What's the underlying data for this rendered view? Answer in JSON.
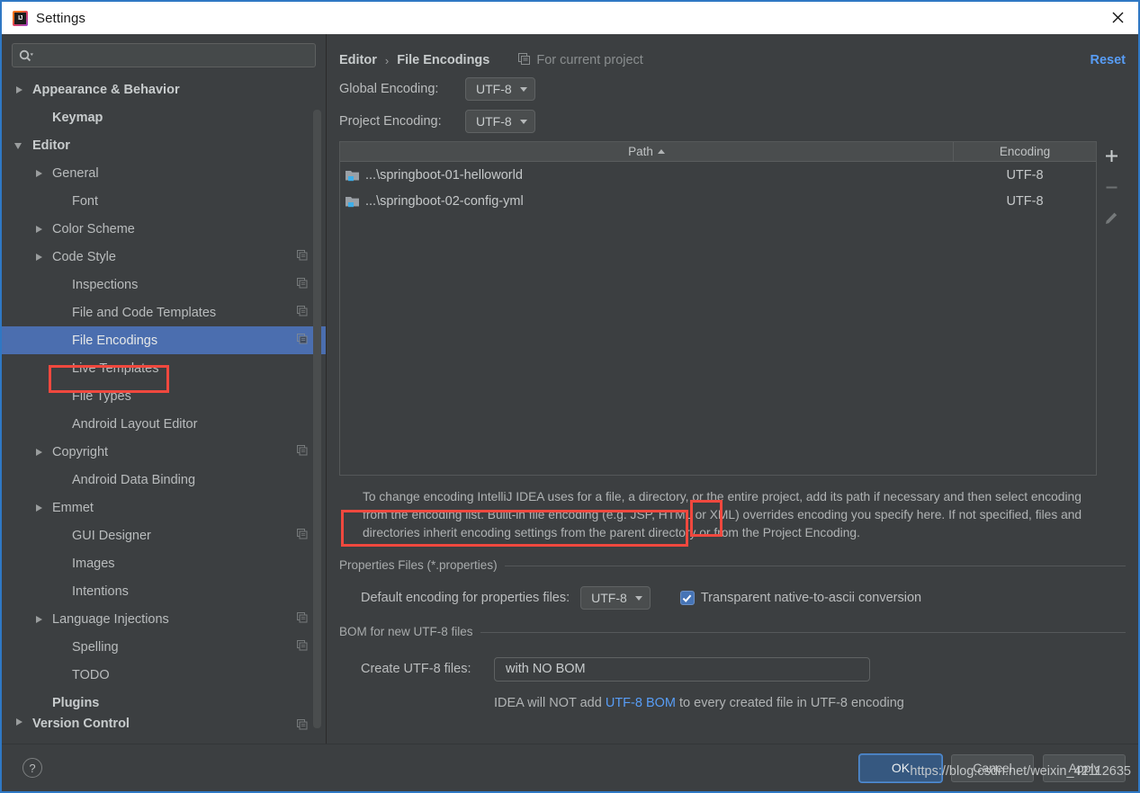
{
  "window": {
    "title": "Settings",
    "logo_icon": "intellij-idea-logo",
    "close_icon": "close-icon"
  },
  "sidebar": {
    "search": {
      "placeholder": "",
      "value": "",
      "icon": "search-icon"
    },
    "items": [
      {
        "label": "Appearance & Behavior",
        "arrow": "right",
        "bold": true,
        "indent": 14,
        "badge": false
      },
      {
        "label": "Keymap",
        "arrow": "none",
        "bold": true,
        "indent": 36,
        "badge": false
      },
      {
        "label": "Editor",
        "arrow": "down",
        "bold": true,
        "indent": 14,
        "badge": false
      },
      {
        "label": "General",
        "arrow": "right",
        "bold": false,
        "indent": 36,
        "badge": false
      },
      {
        "label": "Font",
        "arrow": "none",
        "bold": false,
        "indent": 58,
        "badge": false
      },
      {
        "label": "Color Scheme",
        "arrow": "right",
        "bold": false,
        "indent": 36,
        "badge": false
      },
      {
        "label": "Code Style",
        "arrow": "right",
        "bold": false,
        "indent": 36,
        "badge": true
      },
      {
        "label": "Inspections",
        "arrow": "none",
        "bold": false,
        "indent": 58,
        "badge": true
      },
      {
        "label": "File and Code Templates",
        "arrow": "none",
        "bold": false,
        "indent": 58,
        "badge": true
      },
      {
        "label": "File Encodings",
        "arrow": "none",
        "bold": false,
        "indent": 58,
        "badge": true,
        "selected": true
      },
      {
        "label": "Live Templates",
        "arrow": "none",
        "bold": false,
        "indent": 58,
        "badge": false
      },
      {
        "label": "File Types",
        "arrow": "none",
        "bold": false,
        "indent": 58,
        "badge": false
      },
      {
        "label": "Android Layout Editor",
        "arrow": "none",
        "bold": false,
        "indent": 58,
        "badge": false
      },
      {
        "label": "Copyright",
        "arrow": "right",
        "bold": false,
        "indent": 36,
        "badge": true
      },
      {
        "label": "Android Data Binding",
        "arrow": "none",
        "bold": false,
        "indent": 58,
        "badge": false
      },
      {
        "label": "Emmet",
        "arrow": "right",
        "bold": false,
        "indent": 36,
        "badge": false
      },
      {
        "label": "GUI Designer",
        "arrow": "none",
        "bold": false,
        "indent": 58,
        "badge": true
      },
      {
        "label": "Images",
        "arrow": "none",
        "bold": false,
        "indent": 58,
        "badge": false
      },
      {
        "label": "Intentions",
        "arrow": "none",
        "bold": false,
        "indent": 58,
        "badge": false
      },
      {
        "label": "Language Injections",
        "arrow": "right",
        "bold": false,
        "indent": 36,
        "badge": true
      },
      {
        "label": "Spelling",
        "arrow": "none",
        "bold": false,
        "indent": 58,
        "badge": true
      },
      {
        "label": "TODO",
        "arrow": "none",
        "bold": false,
        "indent": 58,
        "badge": false
      },
      {
        "label": "Plugins",
        "arrow": "none",
        "bold": true,
        "indent": 36,
        "badge": false
      },
      {
        "label": "Version Control",
        "arrow": "right",
        "bold": true,
        "indent": 14,
        "badge": true,
        "clipped": true
      }
    ]
  },
  "pane": {
    "breadcrumb": {
      "parent": "Editor",
      "separator": "›",
      "current": "File Encodings"
    },
    "for_current_project": "For current project",
    "project_scope_icon": "copy-icon",
    "reset_label": "Reset",
    "global_encoding": {
      "label": "Global Encoding:",
      "value": "UTF-8"
    },
    "project_encoding": {
      "label": "Project Encoding:",
      "value": "UTF-8"
    },
    "table": {
      "columns": [
        "Path",
        "Encoding"
      ],
      "sort_column": "Path",
      "sort_direction": "ascending",
      "rows": [
        {
          "icon": "module-folder-icon",
          "path": "...\\springboot-01-helloworld",
          "encoding": "UTF-8"
        },
        {
          "icon": "module-folder-icon",
          "path": "...\\springboot-02-config-yml",
          "encoding": "UTF-8"
        }
      ],
      "toolbar": [
        {
          "name": "add-button",
          "icon": "plus-icon",
          "enabled": true
        },
        {
          "name": "remove-button",
          "icon": "minus-icon",
          "enabled": false
        },
        {
          "name": "edit-button",
          "icon": "pencil-icon",
          "enabled": false
        }
      ]
    },
    "description": "To change encoding IntelliJ IDEA uses for a file, a directory, or the entire project, add its path if necessary and then select encoding from the encoding list. Built-in file encoding (e.g. JSP, HTML or XML) overrides encoding you specify here. If not specified, files and directories inherit encoding settings from the parent directory or from the Project Encoding.",
    "properties_group": {
      "title": "Properties Files (*.properties)",
      "default_encoding_label": "Default encoding for properties files:",
      "default_encoding_value": "UTF-8",
      "transparent_label": "Transparent native-to-ascii conversion",
      "transparent_checked": true
    },
    "bom_group": {
      "title": "BOM for new UTF-8 files",
      "create_label": "Create UTF-8 files:",
      "create_value": "with NO BOM",
      "note_before": "IDEA will NOT add ",
      "note_link": "UTF-8 BOM",
      "note_after": " to every created file in UTF-8 encoding"
    }
  },
  "footer": {
    "help_label": "?",
    "ok_label": "OK",
    "cancel_label": "Cancel",
    "apply_label": "Apply"
  },
  "watermark": "https://blog.csdn.net/weixin_42112635",
  "colors": {
    "accent_blue": "#4b6eaf",
    "link_blue": "#589df6",
    "annotation_red": "#f0483e",
    "background": "#3c3f41"
  }
}
